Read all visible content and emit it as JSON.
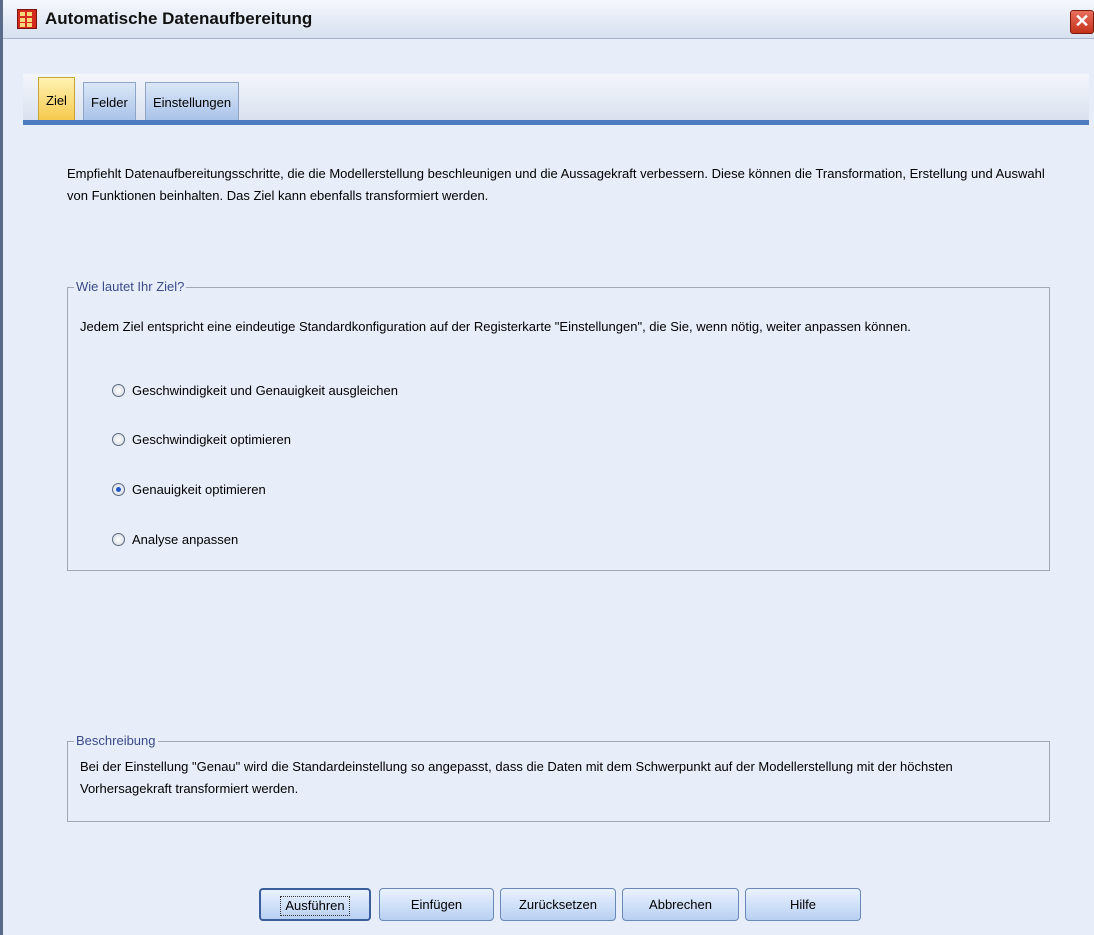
{
  "window": {
    "title": "Automatische Datenaufbereitung",
    "close_label": "✕"
  },
  "tabs": [
    {
      "label": "Ziel",
      "active": true
    },
    {
      "label": "Felder",
      "active": false
    },
    {
      "label": "Einstellungen",
      "active": false
    }
  ],
  "intro_text": "Empfiehlt Datenaufbereitungsschritte, die die Modellerstellung beschleunigen und die Aussagekraft verbessern. Diese können die Transformation, Erstellung und Auswahl von Funktionen beinhalten. Das Ziel kann ebenfalls transformiert werden.",
  "goal_group": {
    "legend": "Wie lautet Ihr Ziel?",
    "description": "Jedem Ziel entspricht eine eindeutige Standardkonfiguration auf der Registerkarte \"Einstellungen\", die Sie, wenn nötig, weiter anpassen können.",
    "options": [
      {
        "label": "Geschwindigkeit und Genauigkeit ausgleichen",
        "checked": false
      },
      {
        "label": "Geschwindigkeit optimieren",
        "checked": false
      },
      {
        "label": "Genauigkeit optimieren",
        "checked": true
      },
      {
        "label": "Analyse anpassen",
        "checked": false
      }
    ]
  },
  "description_group": {
    "legend": "Beschreibung",
    "text": "Bei der Einstellung \"Genau\" wird die Standardeinstellung so angepasst, dass die Daten mit dem Schwerpunkt auf der Modellerstellung mit der höchsten Vorhersagekraft transformiert werden."
  },
  "buttons": {
    "run": "Ausführen",
    "paste": "Einfügen",
    "reset": "Zurücksetzen",
    "cancel": "Abbrechen",
    "help": "Hilfe"
  }
}
